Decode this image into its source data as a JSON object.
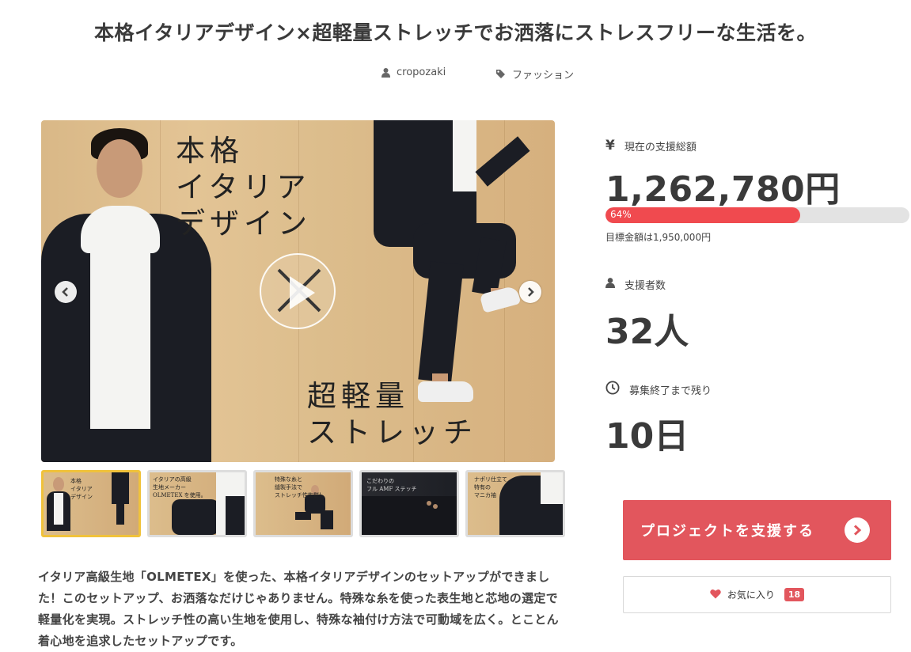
{
  "title": "本格イタリアデザイン×超軽量ストレッチでお洒落にストレスフリーな生活を。",
  "meta": {
    "author": "cropozaki",
    "category": "ファッション"
  },
  "hero": {
    "text_top": "本格\nイタリア\nデザイン",
    "text_bottom": "超軽量\nストレッチ"
  },
  "thumbnails": [
    {
      "text": "本格\nイタリア\nデザイン",
      "active": true
    },
    {
      "text": "イタリアの高級\n生地メーカー\nOLMETEX を使用。",
      "active": false
    },
    {
      "text": "特殊な糸と\n縫製手法で\nストレッチ性抜群!",
      "active": false
    },
    {
      "text": "こだわりの\nフル AMF ステッチ",
      "active": false
    },
    {
      "text": "ナポリ仕立て\n特有の\nマニカ袖",
      "active": false
    }
  ],
  "description": "イタリア高級生地「OLMETEX」を使った、本格イタリアデザインのセットアップができました！このセットアップ、お洒落なだけじゃありません。特殊な糸を使った表生地と芯地の選定で軽量化を実現。ストレッチ性の高い生地を使用し、特殊な袖付け方法で可動域を広く。とことん着心地を追求したセットアップです。",
  "funding": {
    "yen_symbol": "¥",
    "amount_label": "現在の支援総額",
    "amount": "1,262,780円",
    "progress_percent": 64,
    "progress_label": "64%",
    "goal": "目標金額は1,950,000円",
    "backers_label": "支援者数",
    "backers": "32人",
    "remaining_label": "募集終了まで残り",
    "remaining": "10日"
  },
  "buttons": {
    "support": "プロジェクトを支援する",
    "favorite": "お気に入り",
    "favorite_count": "18"
  },
  "colors": {
    "accent": "#e2565d",
    "progress": "#f04a4f",
    "thumb_active": "#f0c23b"
  },
  "icons": {
    "author": "user-icon",
    "category": "tag-icon",
    "yen": "yen-icon",
    "backers": "user-icon",
    "remaining": "clock-icon",
    "support": "chevron-right-circle-icon",
    "favorite": "heart-icon"
  }
}
